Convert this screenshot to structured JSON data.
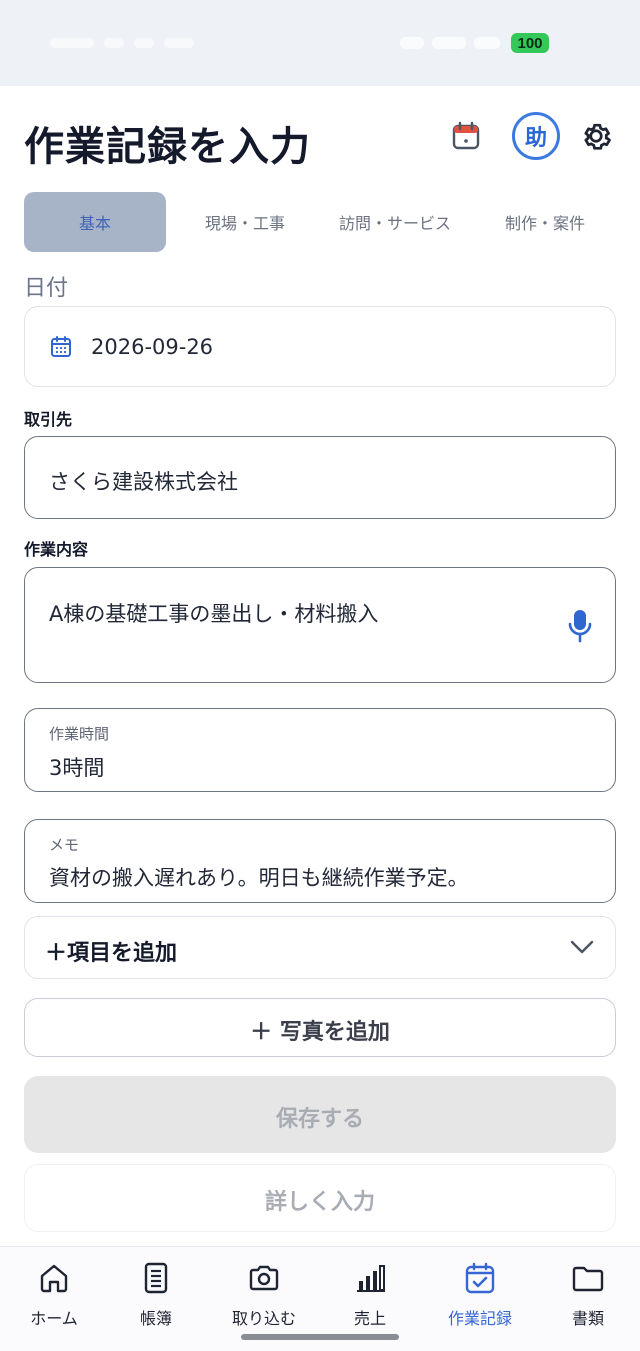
{
  "status_bar": {
    "battery": "100"
  },
  "header": {
    "title": "作業記録を入力",
    "assist_label": "助"
  },
  "tabs": [
    {
      "label": "基本",
      "active": true
    },
    {
      "label": "現場・工事",
      "active": false
    },
    {
      "label": "訪問・サービス",
      "active": false
    },
    {
      "label": "制作・案件",
      "active": false
    }
  ],
  "form": {
    "date": {
      "label": "日付",
      "value": "2026-09-26"
    },
    "client": {
      "label": "取引先",
      "value": "さくら建設株式会社"
    },
    "work_content": {
      "label": "作業内容",
      "value": "A棟の基礎工事の墨出し・材料搬入"
    },
    "work_time": {
      "label": "作業時間",
      "value": "3時間"
    },
    "memo": {
      "label": "メモ",
      "value": "資材の搬入遅れあり。明日も継続作業予定。"
    },
    "add_item": "＋項目を追加",
    "add_photo": "＋ 写真を追加",
    "save": "保存する",
    "detail": "詳しく入力"
  },
  "bottom_nav": [
    {
      "label": "ホーム",
      "icon": "home-icon",
      "active": false
    },
    {
      "label": "帳簿",
      "icon": "ledger-icon",
      "active": false
    },
    {
      "label": "取り込む",
      "icon": "camera-icon",
      "active": false
    },
    {
      "label": "売上",
      "icon": "bar-chart-icon",
      "active": false
    },
    {
      "label": "作業記録",
      "icon": "calendar-check-icon",
      "active": true
    },
    {
      "label": "書類",
      "icon": "folder-icon",
      "active": false
    }
  ],
  "colors": {
    "accent": "#3666d6",
    "tab_active_bg": "#a7b4c8",
    "disabled_button_bg": "#e6e6e6"
  }
}
